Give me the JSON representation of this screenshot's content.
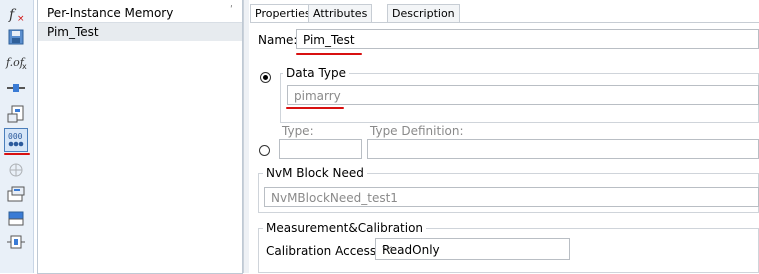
{
  "toolbar": {
    "icons": [
      {
        "name": "function-icon",
        "glyph": "f"
      },
      {
        "name": "save-icon"
      },
      {
        "name": "function-of-function-icon",
        "glyph": "f∘f"
      },
      {
        "name": "connector-icon"
      },
      {
        "name": "component-icon"
      },
      {
        "name": "per-instance-memory-icon",
        "glyph": "000"
      },
      {
        "name": "network-icon"
      },
      {
        "name": "data-element-icon"
      },
      {
        "name": "block-icon"
      },
      {
        "name": "port-icon"
      }
    ]
  },
  "list": {
    "header": "Per-Instance Memory",
    "sort_glyph": "ʹ",
    "items": [
      "Pim_Test"
    ]
  },
  "tabs": [
    "Properties",
    "Attributes",
    "Description"
  ],
  "form": {
    "name_label": "Name:",
    "name_value": "Pim_Test",
    "data_type_group": "Data Type",
    "data_type_value": "pimarry",
    "type_label": "Type:",
    "type_def_label": "Type Definition:",
    "type_value": "",
    "type_def_value": "",
    "nvm_group": "NvM Block Need",
    "nvm_value": "NvMBlockNeed_test1",
    "mc_group": "Measurement&Calibration",
    "calib_label": "Calibration Access:",
    "calib_value": "ReadOnly"
  },
  "colors": {
    "annotation": "#d81010",
    "toolbar_bg": "#e9f0f8",
    "selection": "#e7ebef"
  }
}
